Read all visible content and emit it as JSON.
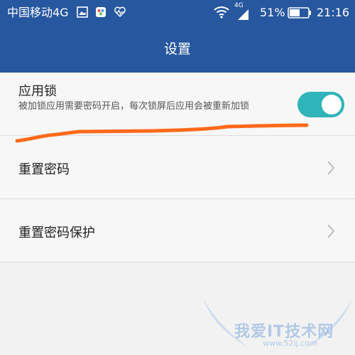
{
  "statusbar": {
    "carrier": "中国移动4G",
    "network_type": "4G",
    "battery_percent": "51%",
    "time": "21:16",
    "icons": [
      "image-icon",
      "app-icon",
      "heart-rate-icon",
      "wifi-icon",
      "signal-icon",
      "battery-icon"
    ]
  },
  "appbar": {
    "title": "设置"
  },
  "app_lock": {
    "title": "应用锁",
    "description": "被加锁应用需要密码开启，每次锁屏后应用会被重新加锁",
    "enabled": true
  },
  "settings": [
    {
      "label": "重置密码"
    },
    {
      "label": "重置密码保护"
    }
  ],
  "watermark": {
    "text": "我爱IT技术网",
    "url": "www.52ij.com"
  },
  "colors": {
    "header": "#27579e",
    "toggle_on": "#2fb4b9",
    "annotation_stroke": "#ff6a1a",
    "background": "#f2f2f2"
  }
}
